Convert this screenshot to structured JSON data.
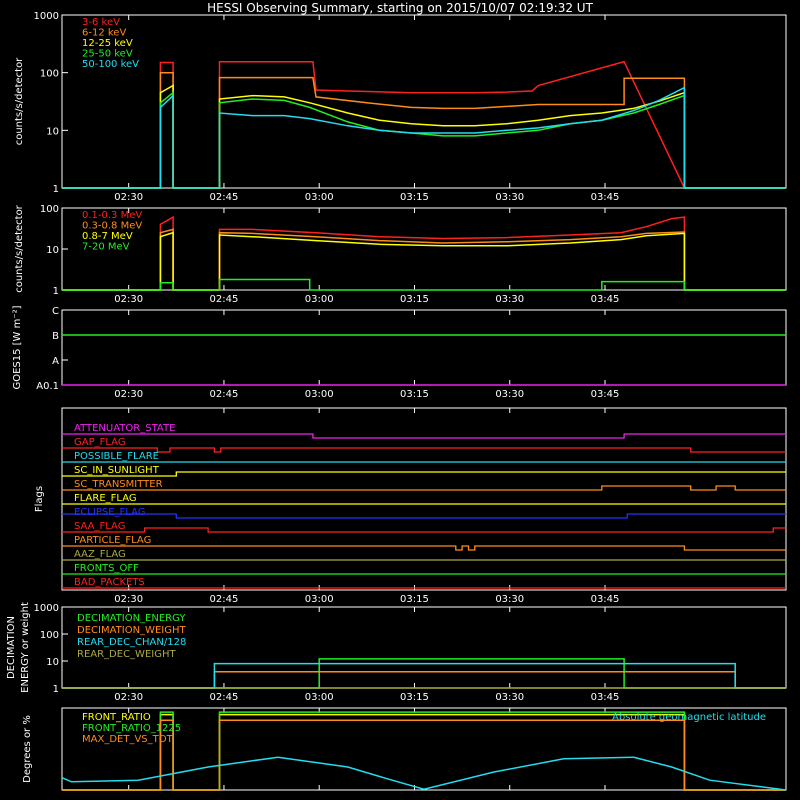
{
  "title": "HESSI Observing Summary, starting on 2015/10/07 02:19:32 UT",
  "time_labels": [
    "02:30",
    "02:45",
    "03:00",
    "03:15",
    "03:30",
    "03:45"
  ],
  "colors": {
    "axis": "#ffffff",
    "red": "#ff2020",
    "orange": "#ff8c1a",
    "yellow": "#ffff00",
    "green": "#22ee22",
    "cyan": "#22ddee",
    "magenta": "#ee22ee",
    "blue": "#2233ff",
    "olive": "#aaaa44"
  },
  "chart_data": [
    {
      "type": "line",
      "panel": "count-rates-low",
      "ylabel": "counts/s/detector",
      "ylog": true,
      "ylim": [
        1,
        1000
      ],
      "yticks": [
        "1",
        "10",
        "100",
        "1000"
      ],
      "xlim_minutes": [
        0,
        114
      ],
      "series": [
        {
          "name": "3-6 keV",
          "color": "red",
          "x": [
            0,
            15.5,
            15.5,
            17.5,
            17.5,
            24.8,
            24.8,
            39.5,
            40,
            45,
            55,
            60,
            65,
            70,
            74,
            75,
            88.5,
            88.5,
            98,
            98,
            114
          ],
          "y": [
            1,
            1,
            150,
            150,
            1,
            1,
            155,
            155,
            50,
            48,
            45,
            45,
            45,
            46,
            48,
            60,
            155,
            155,
            1,
            1,
            1
          ]
        },
        {
          "name": "6-12 keV",
          "color": "orange",
          "x": [
            0,
            15.5,
            15.5,
            17.5,
            17.5,
            24.8,
            24.8,
            39.5,
            40,
            48,
            55,
            60,
            65,
            70,
            75,
            80,
            85,
            88.5,
            88.5,
            98,
            98,
            114
          ],
          "y": [
            1,
            1,
            100,
            100,
            1,
            1,
            82,
            82,
            38,
            30,
            25,
            24,
            24,
            26,
            28,
            28,
            28,
            28,
            80,
            80,
            1,
            1
          ]
        },
        {
          "name": "12-25 keV",
          "color": "yellow",
          "x": [
            0,
            15.5,
            15.5,
            17.5,
            17.5,
            24.8,
            24.8,
            30,
            35,
            39,
            45,
            50,
            55,
            60,
            65,
            70,
            75,
            80,
            85,
            90,
            94,
            98,
            98,
            114
          ],
          "y": [
            1,
            1,
            45,
            60,
            1,
            1,
            35,
            40,
            38,
            30,
            20,
            15,
            13,
            12,
            12,
            13,
            15,
            18,
            20,
            24,
            32,
            45,
            1,
            1
          ]
        },
        {
          "name": "25-50 keV",
          "color": "green",
          "x": [
            0,
            15.5,
            15.5,
            17.5,
            17.5,
            24.8,
            24.8,
            30,
            35,
            39,
            45,
            50,
            55,
            60,
            65,
            70,
            75,
            80,
            85,
            90,
            94,
            98,
            98,
            114
          ],
          "y": [
            1,
            1,
            30,
            45,
            1,
            1,
            30,
            35,
            33,
            25,
            14,
            10,
            9,
            8,
            8,
            9,
            10,
            13,
            15,
            20,
            28,
            40,
            1,
            1
          ]
        },
        {
          "name": "50-100 keV",
          "color": "cyan",
          "x": [
            0,
            15.5,
            15.5,
            17.5,
            17.5,
            24.8,
            24.8,
            30,
            35,
            39,
            45,
            50,
            55,
            60,
            65,
            70,
            75,
            80,
            85,
            90,
            94,
            98,
            98,
            114
          ],
          "y": [
            1,
            1,
            25,
            40,
            1,
            1,
            20,
            18,
            18,
            16,
            12,
            10,
            9,
            9,
            9,
            10,
            11,
            13,
            15,
            22,
            33,
            55,
            1,
            1
          ]
        }
      ]
    },
    {
      "type": "line",
      "panel": "count-rates-high",
      "ylabel": "counts/s/detector",
      "ylog": true,
      "ylim": [
        1,
        100
      ],
      "yticks": [
        "1",
        "10",
        "100"
      ],
      "xlim_minutes": [
        0,
        114
      ],
      "series": [
        {
          "name": "0.1-0.3 MeV",
          "color": "red",
          "x": [
            0,
            15.5,
            15.5,
            17.5,
            17.5,
            24.8,
            24.8,
            30,
            40,
            50,
            60,
            70,
            80,
            88,
            92,
            96,
            98,
            98,
            114
          ],
          "y": [
            1,
            1,
            40,
            60,
            1,
            1,
            30,
            30,
            25,
            20,
            18,
            19,
            22,
            25,
            35,
            55,
            60,
            1,
            1
          ]
        },
        {
          "name": "0.3-0.8 MeV",
          "color": "orange",
          "x": [
            0,
            15.5,
            15.5,
            17.5,
            17.5,
            24.8,
            24.8,
            30,
            40,
            50,
            60,
            70,
            80,
            88,
            92,
            98,
            98,
            114
          ],
          "y": [
            1,
            1,
            25,
            30,
            1,
            1,
            25,
            24,
            20,
            16,
            14,
            15,
            17,
            20,
            24,
            26,
            1,
            1
          ]
        },
        {
          "name": "0.8-7 MeV",
          "color": "yellow",
          "x": [
            0,
            15.5,
            15.5,
            17.5,
            17.5,
            24.8,
            24.8,
            30,
            40,
            50,
            60,
            70,
            80,
            88,
            92,
            98,
            98,
            114
          ],
          "y": [
            1,
            1,
            20,
            25,
            1,
            1,
            22,
            20,
            16,
            13,
            12,
            12,
            14,
            17,
            21,
            24,
            1,
            1
          ]
        },
        {
          "name": "7-20 MeV",
          "color": "green",
          "x": [
            0,
            15.5,
            15.5,
            17.5,
            17.5,
            24.8,
            24.8,
            39,
            39,
            85,
            85,
            98,
            98,
            114
          ],
          "y": [
            1,
            1,
            1.5,
            1.5,
            1,
            1,
            1.8,
            1.8,
            1,
            1,
            1.6,
            1.6,
            1,
            1
          ]
        }
      ]
    },
    {
      "type": "line",
      "panel": "goes",
      "ylabel": "GOES15 [W m⁻²]",
      "yticks": [
        "A0.1",
        "A",
        "B",
        "C"
      ],
      "ylim": [
        0,
        3
      ],
      "xlim_minutes": [
        0,
        114
      ],
      "series": [
        {
          "color": "green",
          "x": [
            0,
            114
          ],
          "y": [
            2.0,
            2.0
          ]
        },
        {
          "color": "magenta",
          "x": [
            0,
            114
          ],
          "y": [
            0.0,
            0.0
          ]
        }
      ]
    },
    {
      "type": "line",
      "panel": "flags",
      "ylabel": "Flags",
      "xlim_minutes": [
        0,
        114
      ],
      "flags": [
        {
          "label": "ATTENUATOR_STATE",
          "color": "magenta",
          "steps": [
            [
              0,
              0
            ],
            [
              39.5,
              -1
            ],
            [
              88.5,
              0
            ]
          ]
        },
        {
          "label": "GAP_FLAG",
          "color": "red",
          "steps": [
            [
              0,
              0
            ],
            [
              15,
              -1
            ],
            [
              17,
              0
            ],
            [
              24,
              -1
            ],
            [
              25,
              0
            ],
            [
              99,
              -1
            ],
            [
              114,
              -1
            ]
          ]
        },
        {
          "label": "POSSIBLE_FLARE",
          "color": "cyan",
          "steps": [
            [
              0,
              0
            ]
          ]
        },
        {
          "label": "SC_IN_SUNLIGHT",
          "color": "yellow",
          "steps": [
            [
              0,
              0
            ],
            [
              18,
              1
            ],
            [
              114,
              1
            ]
          ]
        },
        {
          "label": "SC_TRANSMITTER",
          "color": "orange",
          "steps": [
            [
              0,
              0
            ],
            [
              85,
              1
            ],
            [
              99,
              0
            ],
            [
              103,
              1
            ],
            [
              106,
              0
            ]
          ]
        },
        {
          "label": "FLARE_FLAG",
          "color": "yellow",
          "steps": [
            [
              0,
              0
            ]
          ]
        },
        {
          "label": "ECLIPSE_FLAG",
          "color": "blue",
          "steps": [
            [
              0,
              1
            ],
            [
              18,
              0
            ],
            [
              89,
              1
            ],
            [
              114,
              1
            ]
          ]
        },
        {
          "label": "SAA_FLAG",
          "color": "red",
          "steps": [
            [
              0,
              0
            ],
            [
              13,
              1
            ],
            [
              23,
              0
            ],
            [
              112,
              1
            ],
            [
              114,
              1
            ]
          ]
        },
        {
          "label": "PARTICLE_FLAG",
          "color": "orange",
          "steps": [
            [
              0,
              0
            ],
            [
              62,
              -1
            ],
            [
              63,
              0
            ],
            [
              64,
              -1
            ],
            [
              65,
              0
            ],
            [
              98,
              -1
            ],
            [
              114,
              -1
            ]
          ]
        },
        {
          "label": "AAZ_FLAG",
          "color": "olive",
          "steps": [
            [
              0,
              0
            ]
          ]
        },
        {
          "label": "FRONTS_OFF",
          "color": "green",
          "steps": [
            [
              0,
              0
            ]
          ]
        },
        {
          "label": "BAD_PACKETS",
          "color": "red",
          "steps": [
            [
              0,
              0
            ]
          ]
        }
      ]
    },
    {
      "type": "line",
      "panel": "decimation",
      "ylabel": "DECIMATION ENERGY or weight",
      "ylog": true,
      "ylim": [
        1,
        1000
      ],
      "yticks": [
        "1",
        "10",
        "100",
        "1000"
      ],
      "xlim_minutes": [
        0,
        114
      ],
      "series": [
        {
          "name": "DECIMATION_ENERGY",
          "color": "green",
          "x": [
            0,
            40.5,
            40.5,
            88.5,
            88.5,
            114
          ],
          "y": [
            1,
            1,
            12,
            12,
            1,
            1
          ]
        },
        {
          "name": "DECIMATION_WEIGHT",
          "color": "orange",
          "x": [
            0,
            24,
            24,
            106,
            106,
            114
          ],
          "y": [
            1,
            1,
            4,
            4,
            1,
            1
          ]
        },
        {
          "name": "REAR_DEC_CHAN/128",
          "color": "cyan",
          "x": [
            0,
            24,
            24,
            106,
            106,
            114
          ],
          "y": [
            1,
            1,
            8,
            8,
            1,
            1
          ]
        },
        {
          "name": "REAR_DEC_WEIGHT",
          "color": "olive",
          "x": [
            0,
            114
          ],
          "y": [
            1,
            1
          ]
        }
      ]
    },
    {
      "type": "line",
      "panel": "ratios",
      "ylabel": "Degrees or %",
      "ylim": [
        0,
        100
      ],
      "xlim_minutes": [
        0,
        114
      ],
      "series": [
        {
          "name": "FRONT_RATIO",
          "color": "yellow",
          "x": [
            0,
            15.5,
            15.5,
            17.5,
            17.5,
            24.8,
            24.8,
            98,
            98,
            114
          ],
          "y": [
            0,
            0,
            92,
            92,
            0,
            0,
            92,
            92,
            0,
            0
          ]
        },
        {
          "name": "FRONT_RATIO_1225",
          "color": "green",
          "x": [
            0,
            15.5,
            15.5,
            17.5,
            17.5,
            24.8,
            24.8,
            98,
            98,
            114
          ],
          "y": [
            0,
            0,
            95,
            95,
            0,
            0,
            95,
            95,
            0,
            0
          ]
        },
        {
          "name": "MAX_DET_VS_TOT",
          "color": "orange",
          "x": [
            0,
            15.5,
            15.5,
            17.5,
            17.5,
            24.8,
            24.8,
            98,
            98,
            114
          ],
          "y": [
            0,
            0,
            85,
            85,
            0,
            0,
            85,
            85,
            0,
            0
          ]
        },
        {
          "name": "Absolute geomagnetic latitude",
          "color": "cyan",
          "x": [
            0,
            1.5,
            12,
            23,
            34,
            45,
            52,
            57,
            68,
            79,
            90,
            96,
            102,
            114
          ],
          "y": [
            15,
            10,
            12,
            28,
            40,
            28,
            12,
            1,
            22,
            38,
            40,
            28,
            12,
            0
          ]
        }
      ]
    }
  ]
}
